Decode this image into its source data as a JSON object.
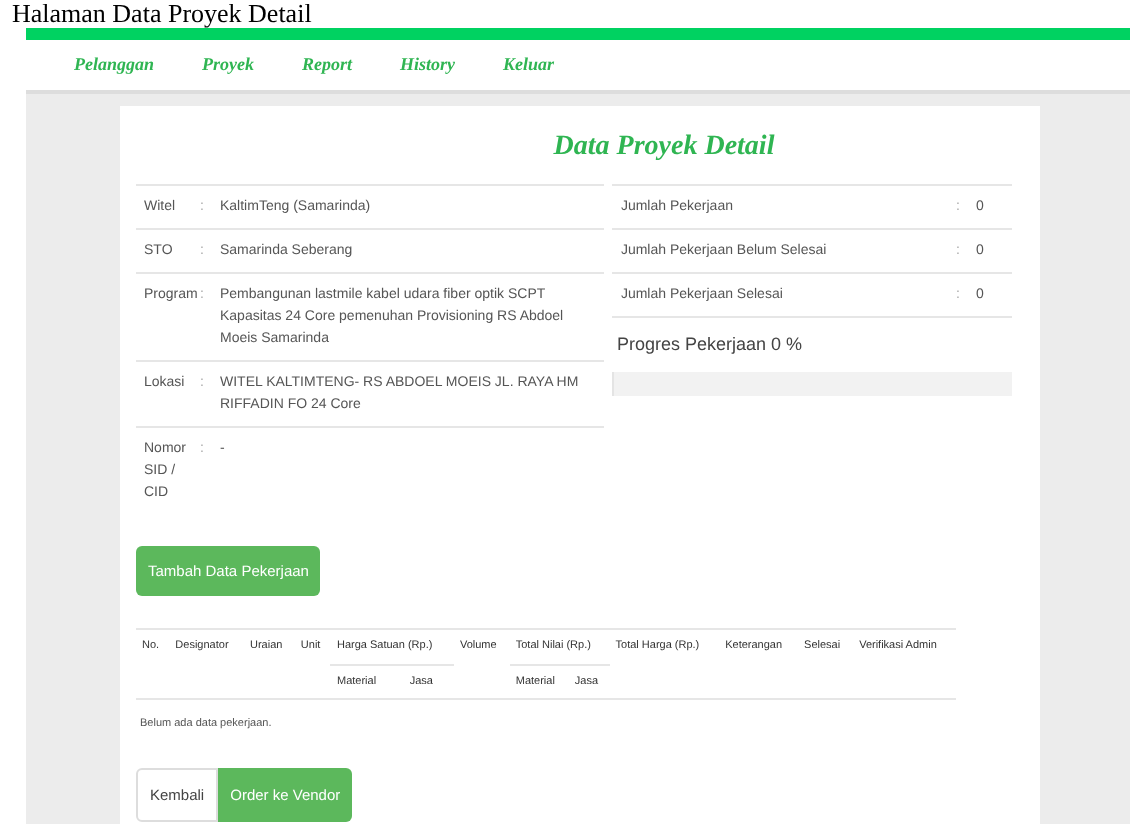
{
  "caption": "Halaman Data Proyek Detail",
  "nav": [
    "Pelanggan",
    "Proyek",
    "Report",
    "History",
    "Keluar"
  ],
  "title": "Data Proyek Detail",
  "details": [
    {
      "label": "Witel",
      "separator": ":",
      "value": "KaltimTeng (Samarinda)"
    },
    {
      "label": "STO",
      "separator": ":",
      "value": "Samarinda Seberang"
    },
    {
      "label": "Program",
      "separator": ":",
      "value": "Pembangunan lastmile kabel udara fiber optik SCPT Kapasitas 24 Core pemenuhan Provisioning RS Abdoel Moeis Samarinda"
    },
    {
      "label": "Lokasi",
      "separator": ":",
      "value": "WITEL KALTIMTENG- RS ABDOEL MOEIS JL. RAYA HM RIFFADIN FO 24 Core"
    },
    {
      "label": "Nomor SID / CID",
      "separator": ":",
      "value": "-"
    }
  ],
  "summary": [
    {
      "label": "Jumlah Pekerjaan",
      "separator": ":",
      "value": "0"
    },
    {
      "label": "Jumlah Pekerjaan Belum Selesai",
      "separator": ":",
      "value": "0"
    },
    {
      "label": "Jumlah Pekerjaan Selesai",
      "separator": ":",
      "value": "0"
    }
  ],
  "progress": {
    "label": "Progres Pekerjaan 0 %",
    "level": 0
  },
  "add_button": "Tambah Data Pekerjaan",
  "table": {
    "columns": [
      {
        "label": "No."
      },
      {
        "label": "Designator"
      },
      {
        "label": "Uraian"
      },
      {
        "label": "Unit"
      },
      {
        "label": "Harga Satuan (Rp.)",
        "sub": [
          "Material",
          "Jasa"
        ]
      },
      {
        "label": "Volume"
      },
      {
        "label": "Total Nilai (Rp.)",
        "sub": [
          "Material",
          "Jasa"
        ]
      },
      {
        "label": "Total Harga (Rp.)"
      },
      {
        "label": "Keterangan"
      },
      {
        "label": "Selesai"
      },
      {
        "label": "Verifikasi Admin"
      }
    ],
    "empty_message": "Belum ada data pekerjaan."
  },
  "buttons": [
    {
      "label": "Kembali",
      "kind": "default"
    },
    {
      "label": "Order ke Vendor",
      "kind": "success"
    }
  ]
}
